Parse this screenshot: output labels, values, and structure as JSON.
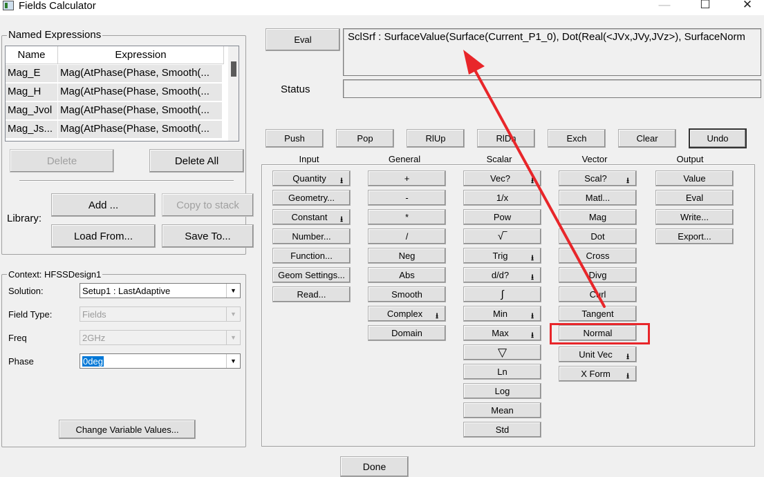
{
  "window": {
    "title": "Fields Calculator"
  },
  "named_expressions": {
    "label": "Named Expressions",
    "columns": [
      "Name",
      "Expression"
    ],
    "rows": [
      {
        "name": "Mag_E",
        "expression": "Mag(AtPhase(Phase, Smooth(..."
      },
      {
        "name": "Mag_H",
        "expression": "Mag(AtPhase(Phase, Smooth(..."
      },
      {
        "name": "Mag_Jvol",
        "expression": "Mag(AtPhase(Phase, Smooth(..."
      },
      {
        "name": "Mag_Js...",
        "expression": "Mag(AtPhase(Phase, Smooth(..."
      }
    ],
    "delete": "Delete",
    "delete_all": "Delete All",
    "library_label": "Library:",
    "add": "Add ...",
    "copy_to_stack": "Copy to stack",
    "load_from": "Load From...",
    "save_to": "Save To..."
  },
  "context": {
    "label": "Context: HFSSDesign1",
    "solution_label": "Solution:",
    "solution_value": "Setup1 : LastAdaptive",
    "field_type_label": "Field Type:",
    "field_type_value": "Fields",
    "freq_label": "Freq",
    "freq_value": "2GHz",
    "phase_label": "Phase",
    "phase_value": "0deg",
    "change_vars": "Change Variable Values..."
  },
  "eval_button": "Eval",
  "expression_display": "SclSrf : SurfaceValue(Surface(Current_P1_0), Dot(Real(<JVx,JVy,JVz>), SurfaceNorm",
  "status_label": "Status",
  "status_value": "",
  "stack_buttons": {
    "push": "Push",
    "pop": "Pop",
    "rlup": "RlUp",
    "rldn": "RlDn",
    "exch": "Exch",
    "clear": "Clear",
    "undo": "Undo"
  },
  "columns": {
    "input": {
      "label": "Input",
      "buttons": [
        "Quantity",
        "Geometry...",
        "Constant",
        "Number...",
        "Function...",
        "Geom Settings...",
        "Read..."
      ]
    },
    "general": {
      "label": "General",
      "buttons": [
        "+",
        "-",
        "*",
        "/",
        "Neg",
        "Abs",
        "Smooth",
        "Complex",
        "Domain"
      ]
    },
    "scalar": {
      "label": "Scalar",
      "buttons": [
        "Vec?",
        "1/x",
        "Pow",
        "√‾",
        "Trig",
        "d/d?",
        "∫",
        "Min",
        "Max",
        "▽",
        "Ln",
        "Log",
        "Mean",
        "Std"
      ]
    },
    "vector": {
      "label": "Vector",
      "buttons": [
        "Scal?",
        "Matl...",
        "Mag",
        "Dot",
        "Cross",
        "Divg",
        "Curl",
        "Tangent",
        "Normal",
        "Unit Vec",
        "X Form"
      ]
    },
    "output": {
      "label": "Output",
      "buttons": [
        "Value",
        "Eval",
        "Write...",
        "Export..."
      ]
    }
  },
  "done": "Done",
  "annotation_color": "#e8262a"
}
